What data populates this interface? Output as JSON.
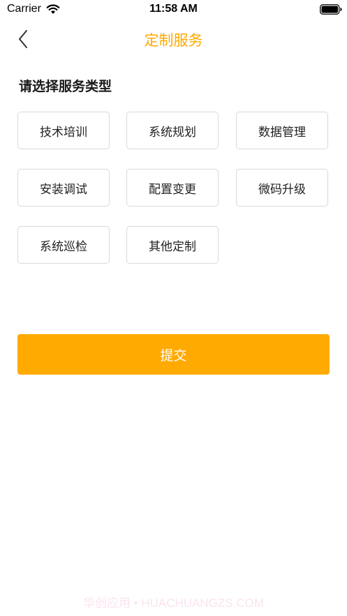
{
  "status_bar": {
    "carrier": "Carrier",
    "time": "11:58 AM",
    "wifi_icon": "wifi-icon",
    "battery_icon": "battery-icon"
  },
  "nav": {
    "back_icon": "chevron-left-icon",
    "title": "定制服务",
    "title_color": "#ffaa00"
  },
  "section": {
    "title": "请选择服务类型"
  },
  "options": [
    "技术培训",
    "系统规划",
    "数据管理",
    "安装调试",
    "配置变更",
    "微码升级",
    "系统巡检",
    "其他定制"
  ],
  "submit": {
    "label": "提交",
    "color": "#ffaa00"
  },
  "watermark": "华创应用 • HUACHUANGZS.COM"
}
